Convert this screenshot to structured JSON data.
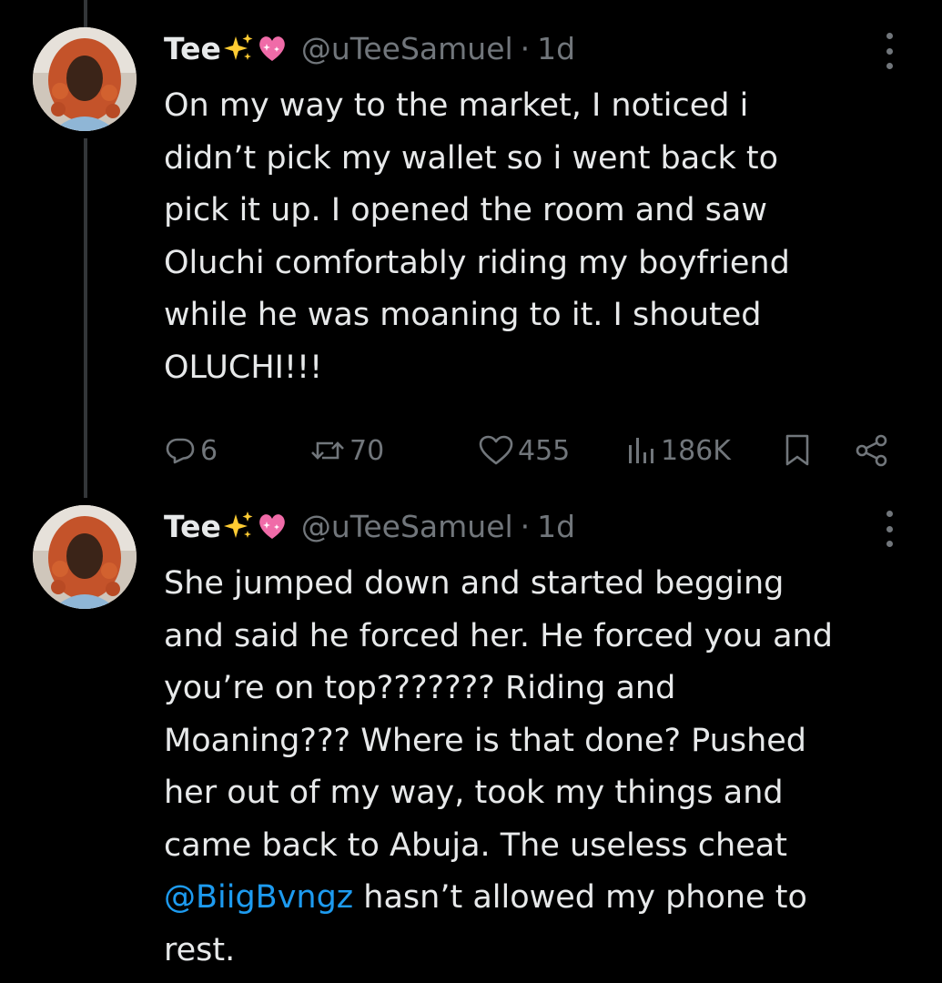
{
  "colors": {
    "background": "#000000",
    "text_primary": "#e7e9ea",
    "text_secondary": "#71767b",
    "link": "#1d9bf0",
    "thread_line": "#333639"
  },
  "tweets": [
    {
      "display_name": "Tee",
      "name_emojis": [
        "sparkles",
        "sparkling-heart"
      ],
      "handle": "@uTeeSamuel",
      "separator": "·",
      "timestamp": "1d",
      "text": "On my way to the market, I noticed i\ndidn’t pick my wallet so i went back to\npick it up. I opened the room and saw\nOluchi comfortably riding my boyfriend\nwhile he was moaning to it. I shouted\nOLUCHI!!!",
      "actions": {
        "replies": "6",
        "retweets": "70",
        "likes": "455",
        "views": "186K",
        "icons": [
          "reply-icon",
          "retweet-icon",
          "like-icon",
          "views-icon",
          "bookmark-icon",
          "share-icon"
        ]
      }
    },
    {
      "display_name": "Tee",
      "name_emojis": [
        "sparkles",
        "sparkling-heart"
      ],
      "handle": "@uTeeSamuel",
      "separator": "·",
      "timestamp": "1d",
      "text_before_mention": "She jumped down and started begging\nand said he forced her. He forced you and\nyou’re on top??????? Riding and\nMoaning??? Where is that done? Pushed\nher out of my way, took my things and\ncame back to Abuja. The useless cheat\n",
      "mention": "@BiigBvngz",
      "text_after_mention": " hasn’t allowed my phone to\nrest."
    }
  ]
}
